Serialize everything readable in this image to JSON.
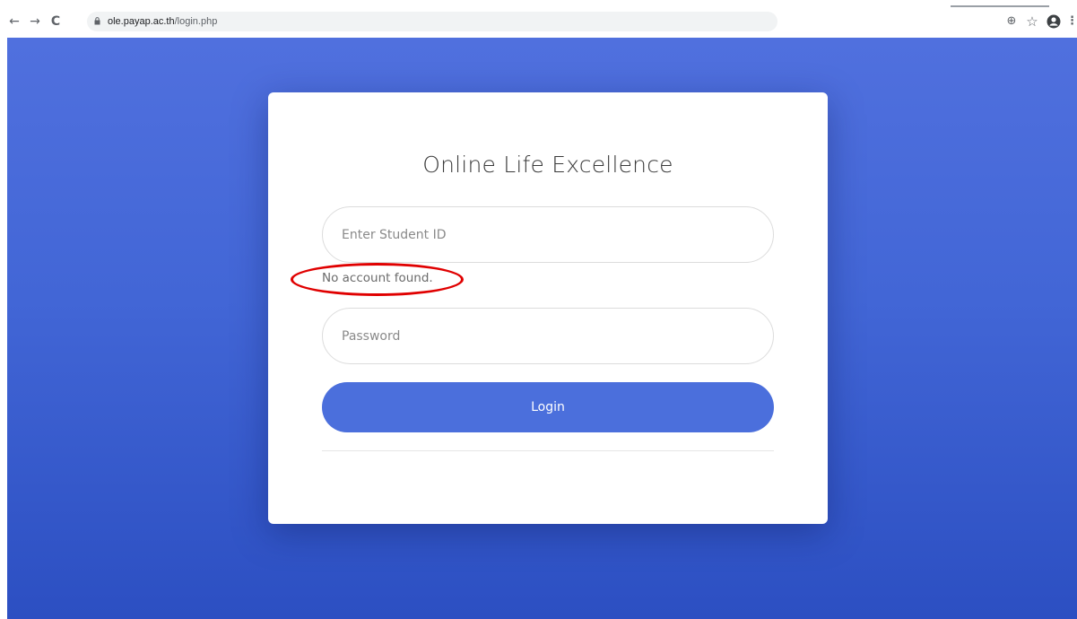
{
  "browser": {
    "back_glyph": "←",
    "forward_glyph": "→",
    "reload_glyph": "C",
    "url_host": "ole.payap.ac.th",
    "url_path": "/login.php",
    "zoom_glyph": "⊕",
    "star_glyph": "☆",
    "menu_glyph": "⋮",
    "icons": [
      "back-arrow-icon",
      "forward-arrow-icon",
      "reload-icon",
      "lock-icon",
      "zoom-icon",
      "star-icon",
      "profile-icon",
      "menu-icon"
    ]
  },
  "page": {
    "gradient_top": "#5070de",
    "gradient_bottom": "#2c4fc2"
  },
  "login_card": {
    "title": "Online Life Excellence",
    "student_id_placeholder": "Enter Student ID",
    "error_message": "No account found.",
    "password_placeholder": "Password",
    "login_label": "Login",
    "button_color": "#4b6fdc",
    "error_highlight_color": "#e00000"
  }
}
